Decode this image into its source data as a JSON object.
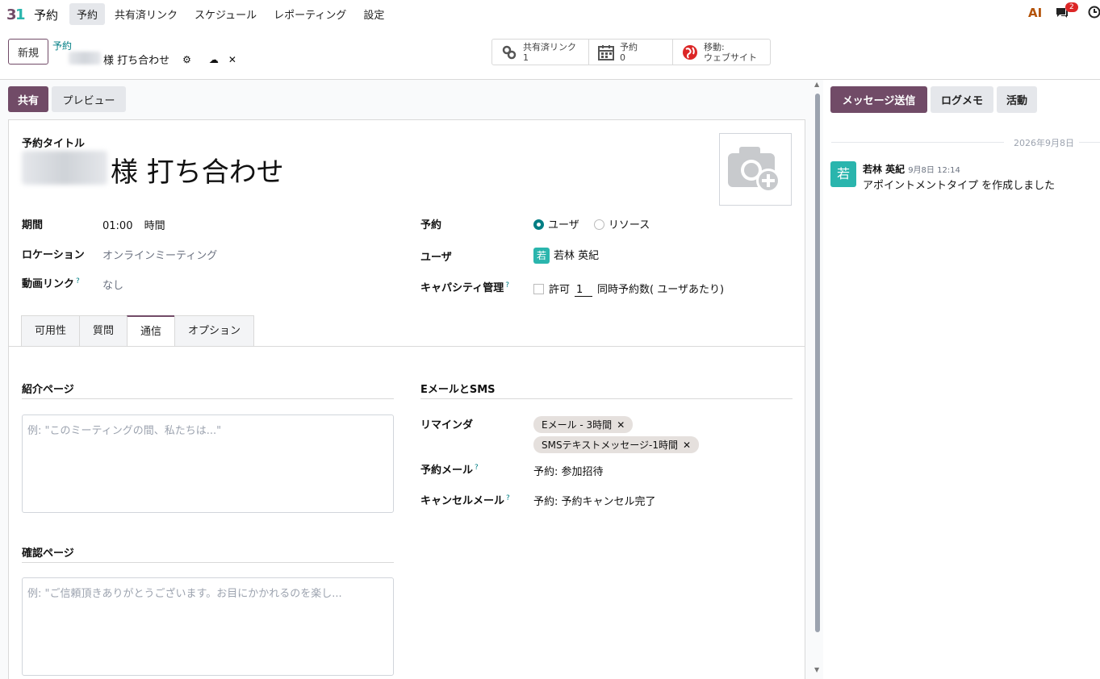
{
  "app": {
    "name": "予約",
    "logo_icon": "calendar-31-logo-icon"
  },
  "menu": [
    "予約",
    "共有済リンク",
    "スケジュール",
    "レポーティング",
    "設定"
  ],
  "nav_right": {
    "ai_label": "AI",
    "message_count": "2"
  },
  "control_panel": {
    "new_button": "新規",
    "breadcrumb": "予約",
    "record_title": "様 打ち合わせ",
    "smart_buttons": [
      {
        "label": "共有済リンク",
        "value": "1",
        "icon": "link-icon"
      },
      {
        "label": "予約",
        "value": "0",
        "icon": "calendar-icon"
      },
      {
        "label": "移動:",
        "value": "ウェブサイト",
        "icon": "globe-icon"
      }
    ]
  },
  "actions": {
    "share": "共有",
    "preview": "プレビュー"
  },
  "form": {
    "title_label": "予約タイトル",
    "title_value": "様 打ち合わせ",
    "left_fields": {
      "duration_label": "期間",
      "duration_value": "01:00",
      "duration_unit": "時間",
      "location_label": "ロケーション",
      "location_value": "オンラインミーティング",
      "video_label": "動画リンク",
      "video_value": "なし"
    },
    "right_fields": {
      "booking_label": "予約",
      "booking_option_user": "ユーザ",
      "booking_option_resource": "リソース",
      "user_label": "ユーザ",
      "user_avatar": "若",
      "user_name": "若林 英紀",
      "capacity_label": "キャパシティ管理",
      "capacity_allow": "許可",
      "capacity_number": "1",
      "capacity_suffix": "同時予約数( ユーザあたり)"
    },
    "tabs": [
      "可用性",
      "質問",
      "通信",
      "オプション"
    ],
    "intro_page": {
      "title": "紹介ページ",
      "placeholder": "例: \"このミーティングの間、私たちは...\""
    },
    "confirm_page": {
      "title": "確認ページ",
      "placeholder": "例: \"ご信頼頂きありがとうございます。お目にかかれるのを楽し..."
    },
    "email_sms": {
      "title": "EメールとSMS",
      "reminder_label": "リマインダ",
      "reminder_tags": [
        "Eメール - 3時間",
        "SMSテキストメッセージ-1時間"
      ],
      "booking_mail_label": "予約メール",
      "booking_mail_value": "予約: 参加招待",
      "cancel_mail_label": "キャンセルメール",
      "cancel_mail_value": "予約: 予約キャンセル完了"
    }
  },
  "chatter": {
    "send_message": "メッセージ送信",
    "log_note": "ログメモ",
    "activity": "活動",
    "date_separator": "2026年9月8日",
    "message": {
      "avatar": "若",
      "author": "若林 英紀",
      "time": "9月8日 12:14",
      "body": "アポイントメントタイプ を作成しました"
    }
  },
  "colors": {
    "brand": "#714b67",
    "accent": "#017e84",
    "avatar": "#2ab5ad",
    "badge": "#dc2626"
  }
}
